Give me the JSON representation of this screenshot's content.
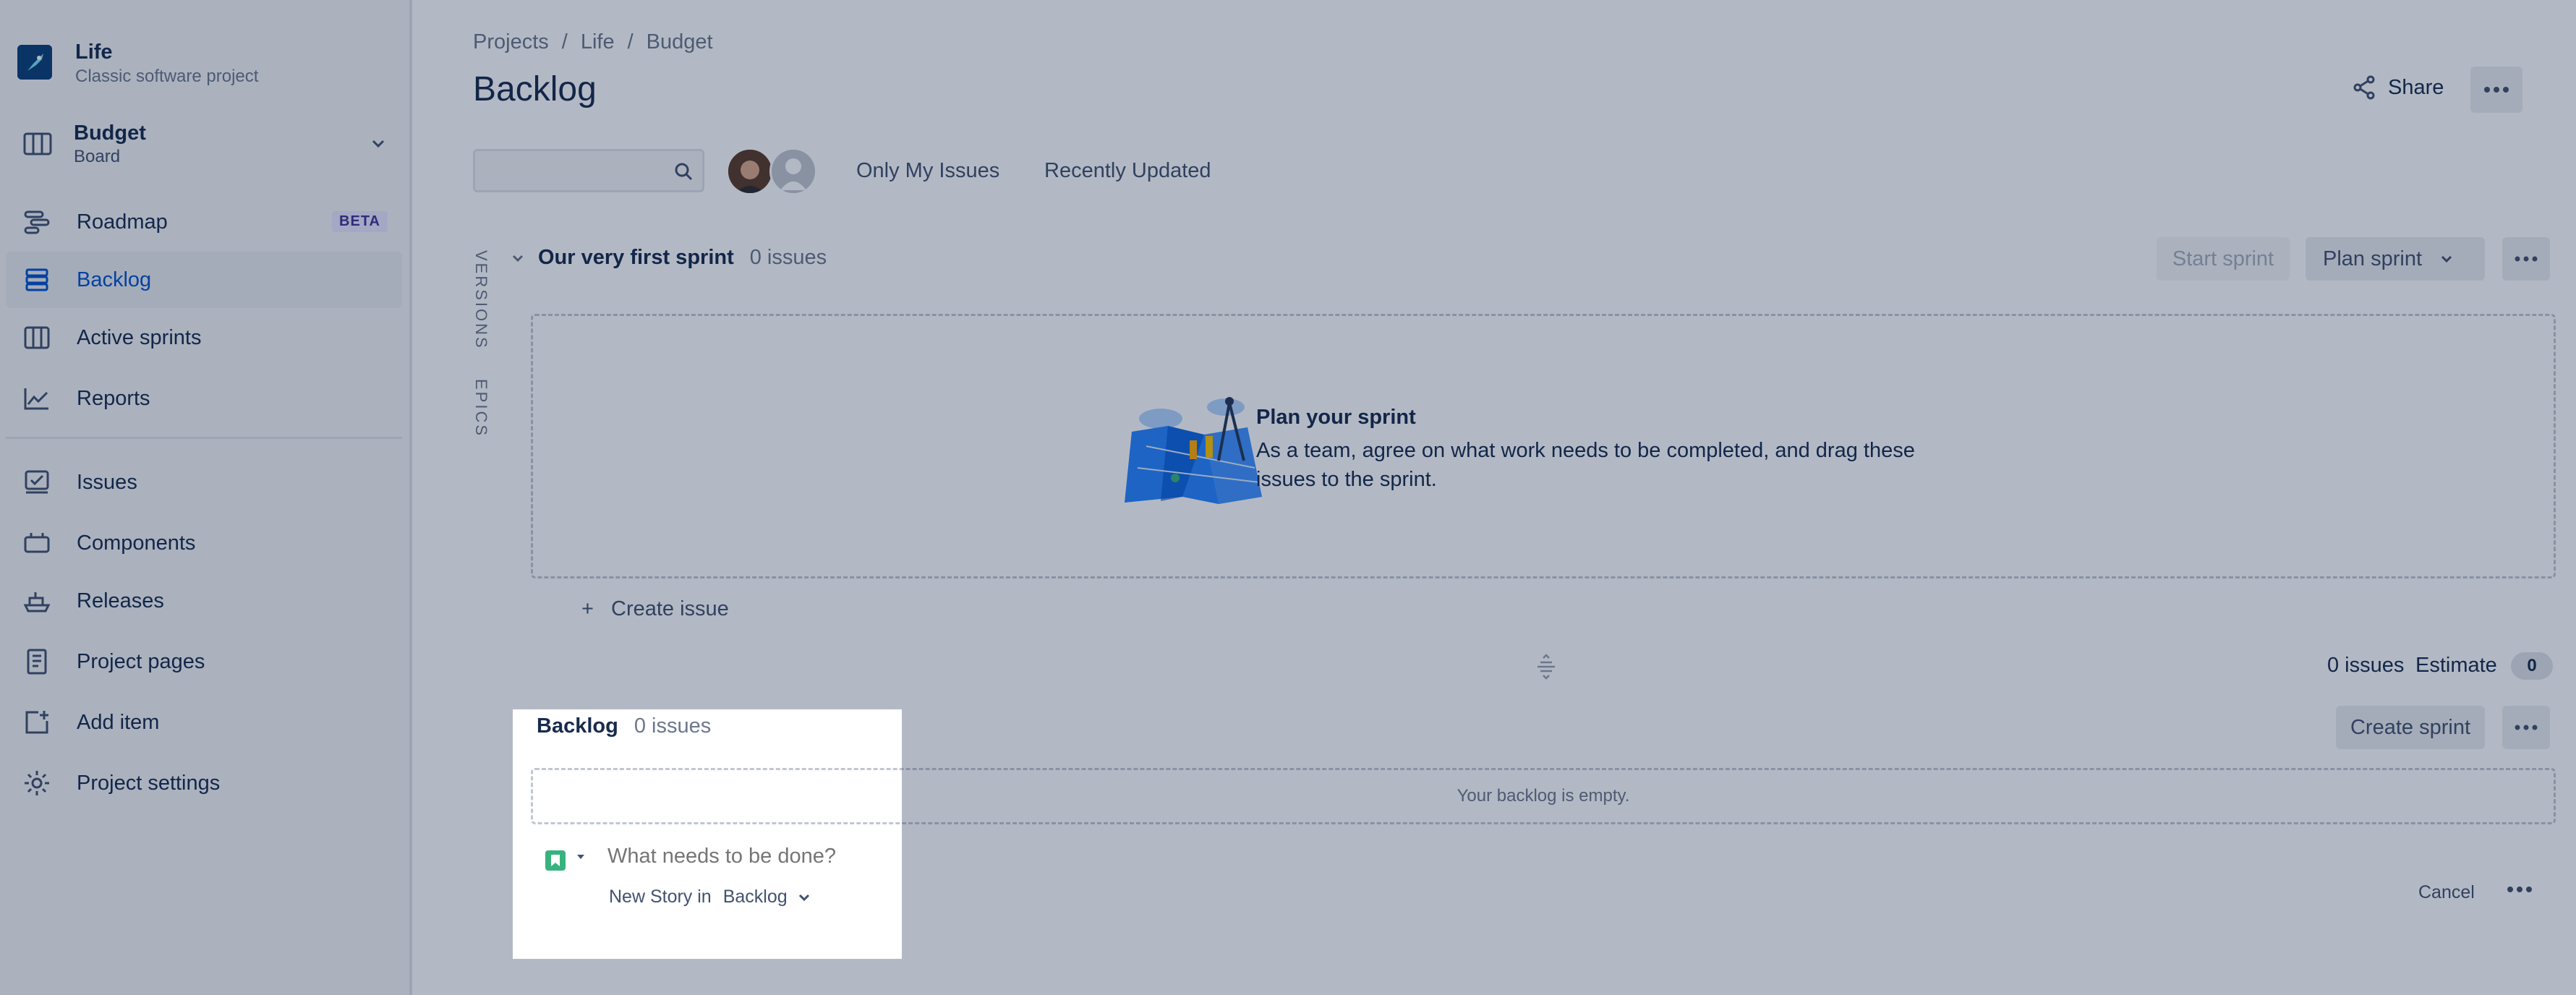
{
  "project": {
    "name": "Life",
    "type": "Classic software project"
  },
  "board": {
    "name": "Budget",
    "sub": "Board"
  },
  "nav": {
    "roadmap": "Roadmap",
    "beta": "BETA",
    "backlog": "Backlog",
    "active_sprints": "Active sprints",
    "reports": "Reports",
    "issues": "Issues",
    "components": "Components",
    "releases": "Releases",
    "project_pages": "Project pages",
    "add_item": "Add item",
    "project_settings": "Project settings"
  },
  "breadcrumb": {
    "projects": "Projects",
    "sep": "/",
    "life": "Life",
    "budget": "Budget"
  },
  "page_title": "Backlog",
  "header": {
    "share": "Share"
  },
  "search": {
    "placeholder": ""
  },
  "quick_filters": {
    "only_my_issues": "Only My Issues",
    "recently_updated": "Recently Updated"
  },
  "side_tabs": {
    "versions": "VERSIONS",
    "epics": "EPICS"
  },
  "sprint": {
    "name": "Our very first sprint",
    "count": "0 issues",
    "start": "Start sprint",
    "plan": "Plan sprint",
    "empty_title": "Plan your sprint",
    "empty_desc": "As a team, agree on what work needs to be completed, and drag these issues to the sprint.",
    "create_issue": "Create issue",
    "create_plus": "+"
  },
  "summary": {
    "issues": "0 issues",
    "estimate_label": "Estimate",
    "estimate_value": "0"
  },
  "backlog": {
    "title": "Backlog",
    "count": "0 issues",
    "create_sprint": "Create sprint",
    "empty": "Your backlog is empty.",
    "new_placeholder": "What needs to be done?",
    "new_meta_prefix": "New Story in",
    "new_meta_target": "Backlog",
    "cancel": "Cancel"
  },
  "colors": {
    "accent": "#0052cc",
    "story": "#36b37e",
    "overlay": "rgba(9,30,66,0.31)"
  }
}
